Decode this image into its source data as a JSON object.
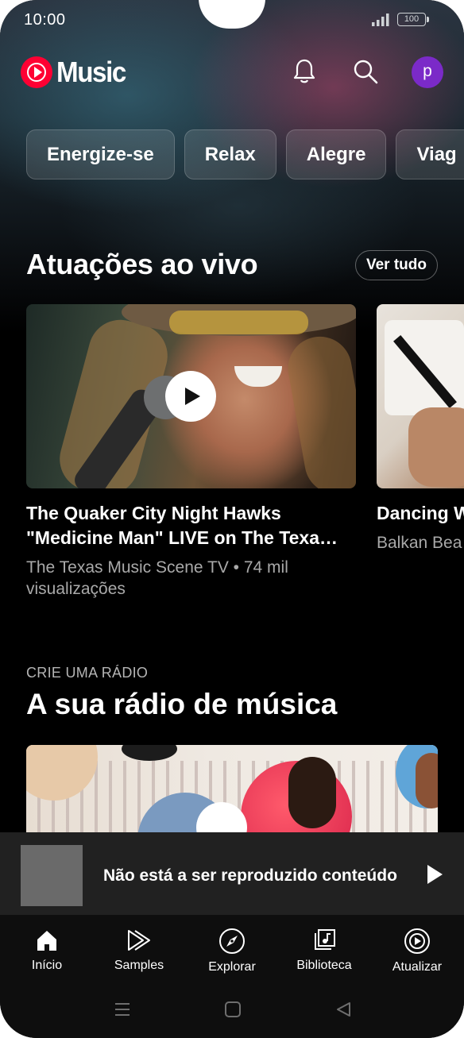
{
  "status_bar": {
    "time": "10:00",
    "battery": "100"
  },
  "header": {
    "app_name": "Music",
    "avatar_letter": "p"
  },
  "chips": [
    "Energize-se",
    "Relax",
    "Alegre",
    "Viag"
  ],
  "live_section": {
    "title": "Atuações ao vivo",
    "see_all": "Ver tudo",
    "cards": [
      {
        "title_line1": "The Quaker City Night Hawks",
        "title_line2": "\"Medicine Man\" LIVE on The Texa…",
        "subtitle_line1": "The Texas Music Scene TV • 74 mil",
        "subtitle_line2": "visualizações"
      },
      {
        "title_line1": "Dancing W",
        "subtitle_line1": "Balkan Bea"
      }
    ]
  },
  "radio_section": {
    "kicker": "CRIE UMA RÁDIO",
    "title": "A sua rádio de música"
  },
  "mini_player": {
    "text": "Não está a ser reproduzido conteúdo"
  },
  "bottom_nav": [
    {
      "label": "Início",
      "icon": "home-icon",
      "active": true
    },
    {
      "label": "Samples",
      "icon": "samples-icon"
    },
    {
      "label": "Explorar",
      "icon": "explore-icon"
    },
    {
      "label": "Biblioteca",
      "icon": "library-icon"
    },
    {
      "label": "Atualizar",
      "icon": "upgrade-icon"
    }
  ],
  "colors": {
    "brand_red": "#ff0033",
    "avatar": "#7b2ac8",
    "background": "#000000"
  }
}
